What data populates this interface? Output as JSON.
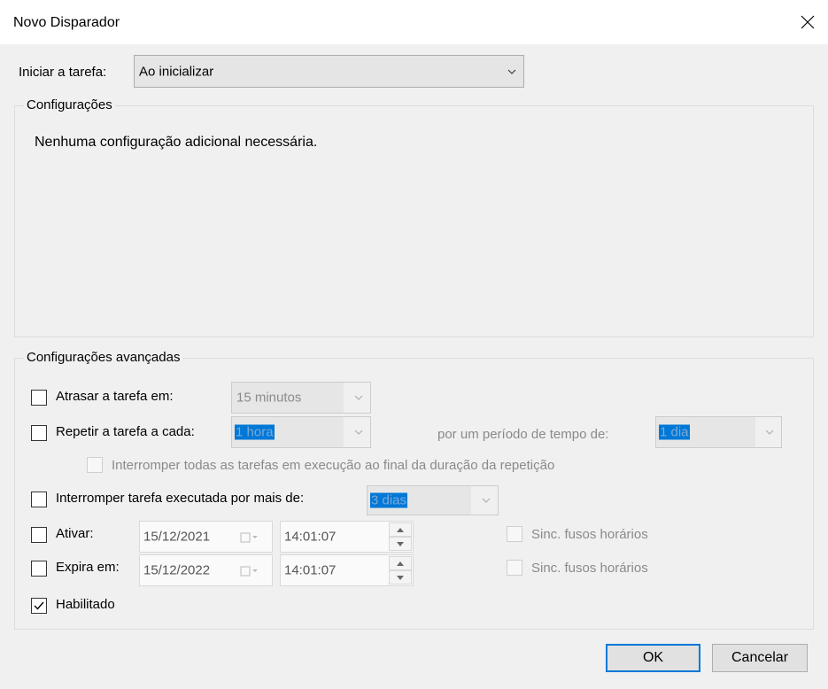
{
  "window": {
    "title": "Novo Disparador"
  },
  "start_task": {
    "label": "Iniciar a tarefa:",
    "value": "Ao inicializar"
  },
  "settings": {
    "title": "Configurações",
    "message": "Nenhuma configuração adicional necessária."
  },
  "advanced": {
    "title": "Configurações avançadas",
    "delay": {
      "label": "Atrasar a tarefa em:",
      "value": "15 minutos",
      "checked": false
    },
    "repeat": {
      "label": "Repetir a tarefa a cada:",
      "value": "1 hora",
      "checked": false,
      "duration_label": "por um período de tempo de:",
      "duration_value": "1 dia"
    },
    "stop_all": {
      "label": "Interromper todas as tarefas em execução ao final da duração da repetição",
      "checked": false
    },
    "stop_longer": {
      "label": "Interromper tarefa executada por mais de:",
      "value": "3 dias",
      "checked": false
    },
    "activate": {
      "label": "Ativar:",
      "date": "15/12/2021",
      "time": "14:01:07",
      "sync_label": "Sinc. fusos horários",
      "checked": false
    },
    "expire": {
      "label": "Expira em:",
      "date": "15/12/2022",
      "time": "14:01:07",
      "sync_label": "Sinc. fusos horários",
      "checked": false
    },
    "enabled": {
      "label": "Habilitado",
      "checked": true
    }
  },
  "buttons": {
    "ok": "OK",
    "cancel": "Cancelar"
  },
  "icons": {
    "close": "close-icon",
    "chevron": "chevron-down-icon",
    "check": "checkmark-icon",
    "calendar": "calendar-icon",
    "spin_up": "spin-up-icon",
    "spin_down": "spin-down-icon"
  },
  "colors": {
    "accent": "#0078d7",
    "background": "#f0f0f0",
    "border": "#adadad"
  }
}
